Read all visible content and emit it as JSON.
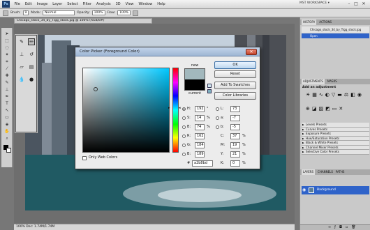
{
  "app": {
    "logo_text": "Ps",
    "menu": [
      "File",
      "Edit",
      "Image",
      "Layer",
      "Select",
      "Filter",
      "Analysis",
      "3D",
      "View",
      "Window",
      "Help"
    ],
    "workspace_label": "MST WORKSPACE ▾",
    "window_controls": [
      "–",
      "□",
      "✕"
    ]
  },
  "options_bar": {
    "brush_label": "Brush:",
    "brush_size": "9",
    "mode_label": "Mode:",
    "mode_value": "Normal",
    "opacity_label": "Opacity:",
    "opacity_value": "100%",
    "flow_label": "Flow:",
    "flow_value": "100%"
  },
  "document": {
    "tab_title": "Chicago_stock_34_by_Tigg_stock.jpg @ 100% (RGB/8#)",
    "status_text": "100%    Doc: 1.74M/1.74M"
  },
  "toolbox": {
    "tools": [
      {
        "name": "spot-healing-brush-icon",
        "glyph": "✎"
      },
      {
        "name": "brush-icon",
        "glyph": "🖌"
      },
      {
        "name": "clone-stamp-icon",
        "glyph": "⎈"
      },
      {
        "name": "history-brush-icon",
        "glyph": "↺"
      },
      {
        "name": "eraser-icon",
        "glyph": "▱"
      },
      {
        "name": "gradient-icon",
        "glyph": "▤"
      },
      {
        "name": "blur-icon",
        "glyph": "💧"
      },
      {
        "name": "dodge-icon",
        "glyph": "●"
      }
    ]
  },
  "color_picker": {
    "title": "Color Picker (Foreground Color)",
    "new_label": "new",
    "current_label": "current",
    "only_web_colors_label": "Only Web Colors",
    "hex_label": "#",
    "hex_value": "a2b8bd",
    "buttons": {
      "ok": "OK",
      "reset": "Reset",
      "add_to_swatches": "Add To Swatches",
      "color_libraries": "Color Libraries"
    },
    "hsb": [
      {
        "label": "H:",
        "value": "192",
        "unit": "°"
      },
      {
        "label": "S:",
        "value": "14",
        "unit": "%"
      },
      {
        "label": "B:",
        "value": "74",
        "unit": "%"
      }
    ],
    "rgb": [
      {
        "label": "R:",
        "value": "162"
      },
      {
        "label": "G:",
        "value": "184"
      },
      {
        "label": "B:",
        "value": "189"
      }
    ],
    "lab": [
      {
        "label": "L:",
        "value": "73"
      },
      {
        "label": "a:",
        "value": "-7"
      },
      {
        "label": "b:",
        "value": "-5"
      }
    ],
    "cmyk": [
      {
        "label": "C:",
        "value": "37",
        "unit": "%"
      },
      {
        "label": "M:",
        "value": "19",
        "unit": "%"
      },
      {
        "label": "Y:",
        "value": "21",
        "unit": "%"
      },
      {
        "label": "K:",
        "value": "0",
        "unit": "%"
      }
    ],
    "new_color": "#a2b8bd",
    "current_color": "#000000",
    "field_hue_color": "#00c8ff"
  },
  "right_panel": {
    "history_tabs": [
      "HISTORY",
      "ACTIONS"
    ],
    "history_items": [
      "Chicago_stock_34_by_Tigg_stock.jpg",
      "Open"
    ],
    "adjust_tabs": [
      "ADJUSTMENTS",
      "MASKS"
    ],
    "adjust_title": "Add an adjustment",
    "presets": [
      "Levels Presets",
      "Curves Presets",
      "Exposure Presets",
      "Hue/Saturation Presets",
      "Black & White Presets",
      "Channel Mixer Presets",
      "Selective Color Presets"
    ],
    "layers_tabs": [
      "LAYERS",
      "CHANNELS",
      "PATHS"
    ],
    "layer_name": "Background"
  }
}
